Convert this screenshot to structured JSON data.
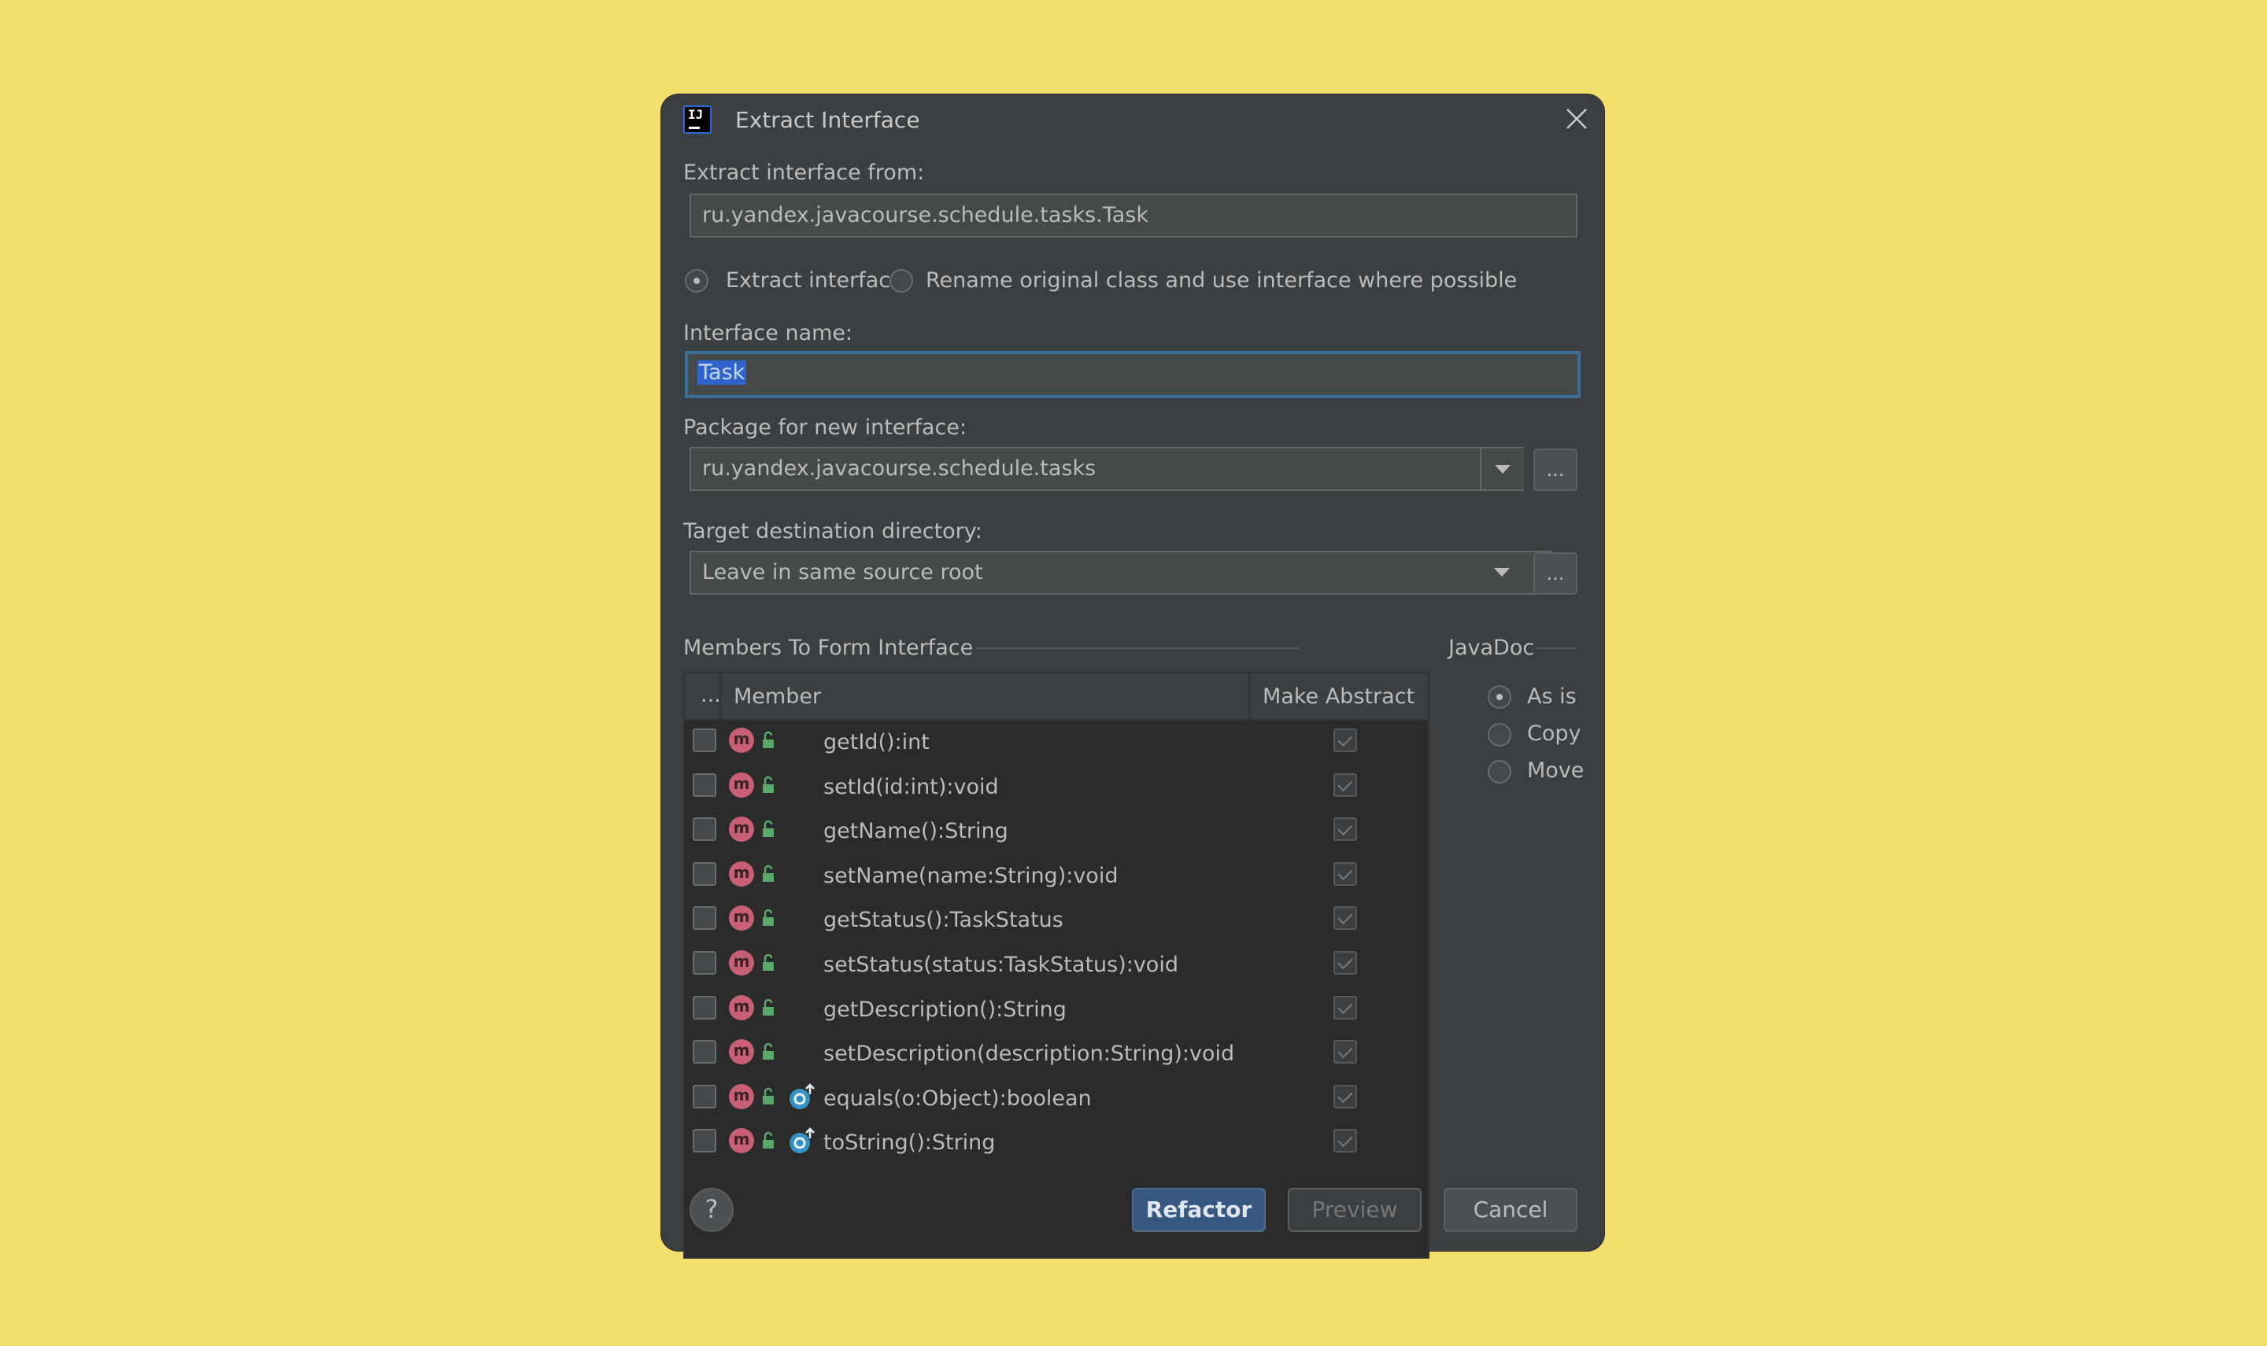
{
  "dialog": {
    "title": "Extract Interface",
    "extract_from_label": "Extract interface from:",
    "extract_from_value": "ru.yandex.javacourse.schedule.tasks.Task",
    "mode_options": [
      "Extract interface",
      "Rename original class and use interface where possible"
    ],
    "mode_selected": "Extract interface",
    "interface_name_label": "Interface name:",
    "interface_name_value": "Task",
    "package_label": "Package for new interface:",
    "package_value": "ru.yandex.javacourse.schedule.tasks",
    "target_dir_label": "Target destination directory:",
    "target_dir_value": "Leave in same source root",
    "browse_label": "...",
    "members_section": "Members To Form Interface",
    "table_headers": {
      "more": "...",
      "member": "Member",
      "make_abstract": "Make Abstract"
    },
    "members": [
      {
        "name": "getId():int",
        "checked": false,
        "make_abstract": true,
        "override": false
      },
      {
        "name": "setId(id:int):void",
        "checked": false,
        "make_abstract": true,
        "override": false
      },
      {
        "name": "getName():String",
        "checked": false,
        "make_abstract": true,
        "override": false
      },
      {
        "name": "setName(name:String):void",
        "checked": false,
        "make_abstract": true,
        "override": false
      },
      {
        "name": "getStatus():TaskStatus",
        "checked": false,
        "make_abstract": true,
        "override": false
      },
      {
        "name": "setStatus(status:TaskStatus):void",
        "checked": false,
        "make_abstract": true,
        "override": false
      },
      {
        "name": "getDescription():String",
        "checked": false,
        "make_abstract": true,
        "override": false
      },
      {
        "name": "setDescription(description:String):void",
        "checked": false,
        "make_abstract": true,
        "override": false
      },
      {
        "name": "equals(o:Object):boolean",
        "checked": false,
        "make_abstract": true,
        "override": true
      },
      {
        "name": "toString():String",
        "checked": false,
        "make_abstract": true,
        "override": true
      }
    ],
    "javadoc_section": "JavaDoc",
    "javadoc_options": [
      "As is",
      "Copy",
      "Move"
    ],
    "javadoc_selected": "As is",
    "buttons": {
      "help": "?",
      "refactor": "Refactor",
      "preview": "Preview",
      "cancel": "Cancel"
    },
    "colors": {
      "background": "#f4df6c",
      "dialog": "#3c3f41",
      "accent": "#365880",
      "method_icon": "#c75f75"
    },
    "icons": [
      "intellij-logo-icon",
      "close-icon",
      "chevron-down-icon",
      "method-icon",
      "public-lock-icon",
      "override-icon",
      "help-icon"
    ]
  }
}
